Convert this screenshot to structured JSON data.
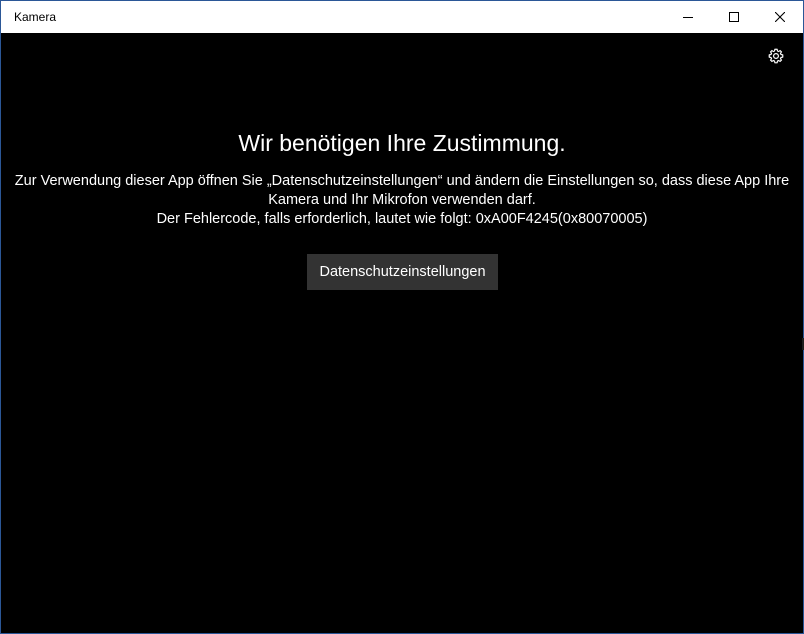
{
  "window": {
    "title": "Kamera",
    "controls": {
      "minimize_icon": "minimize-icon",
      "maximize_icon": "maximize-icon",
      "close_icon": "close-icon"
    }
  },
  "toolbar": {
    "settings_icon": "gear-icon"
  },
  "message": {
    "heading": "Wir benötigen Ihre Zustimmung.",
    "line1": "Zur Verwendung dieser App öffnen Sie „Datenschutzeinstellungen“ und ändern die Einstellungen so, dass diese App Ihre",
    "line2": "Kamera und Ihr Mikrofon verwenden darf.",
    "line3": "Der Fehlercode, falls erforderlich, lautet wie folgt: 0xA00F4245(0x80070005)"
  },
  "actions": {
    "privacy_button_label": "Datenschutzeinstellungen"
  },
  "colors": {
    "background": "#000000",
    "titlebar": "#ffffff",
    "button": "#333333",
    "text": "#ffffff"
  }
}
